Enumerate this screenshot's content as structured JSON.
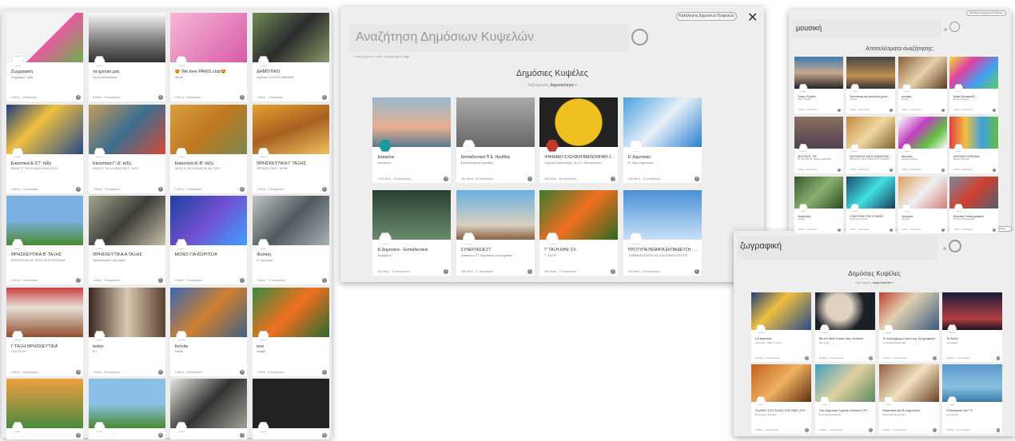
{
  "p1": {
    "cards": [
      {
        "t": "Ζωγραφική",
        "s": "Ζωγραφική - ipiek",
        "m": "4 Μέλη · 4 Ανάρτηση"
      },
      {
        "t": "τα χρόνια μας",
        "s": "τεχνη αναπτυξιοκου",
        "m": "8 Μέλη · 4 Αναρτήσεις"
      },
      {
        "t": "😍 We love PARIS club😍",
        "s": "αποικτ",
        "m": "0 Μέλη · 0 Ανάρτηση"
      },
      {
        "t": "ΔΗΜΟΤΙΚΟ",
        "s": "Δημοτικό ΣΧΟΛΕΙΟ ΑΘΗΝΩΝ",
        "m": "1 Μέλη · 1 Ανάρτηση"
      },
      {
        "t": "Εικαστικά Ε-ΣΤ' τάξη",
        "s": "ΦΙΛΟΣ ΣΤ' ΤΑΞΗ ΕΙΚΑΣΤΙΚΑ Α ΤΑΞΗ",
        "m": "2 Μέλη · 1 Αναρτήσεις"
      },
      {
        "t": "Εικαστικά Γ'-Δ' τάξη",
        "s": "ΦΙΛΟΣ Γ' ΤΑΞΗ ΕΙΚΑΣΤΙΚΑ Γ' ΤΑΞΗ",
        "m": "1 Μέλη · 1 Αναρτήσεις"
      },
      {
        "t": "Εικαστικά Α'-Β' τάξη",
        "s": "ΦΙΛΟΣ Α' ΤΑΞΗ ΕΙΚΑΣΤΙΚΑ Β' ΤΑΞΗ",
        "m": "1 Μέλη · 1 Αναρτήσεις"
      },
      {
        "t": "ΘΡΗΣΚΕΥΤΙΚΑ Γ ΤΑΞΗΣ",
        "s": "ΘΡΗΣΚΕΥΤΙΚΑ Γ ΤΑΞΗΣ",
        "m": "1 Μέλη · 1 Αναρτήσεις"
      },
      {
        "t": "ΘΡΗΣΚΕΥΤΙΚΑ Β' ΤΑΞΗΣ",
        "s": "ΘΡΗΣΚΕΥΤΙΚΑ Β' ΤΑΞΗΣ ΧΡΙΣΤΟΥΓΕΝΝΑ",
        "m": "1 Μέλη · 1 Αναρτήσεις"
      },
      {
        "t": "ΘΡΗΣΚΕΥΤΙΚΑ Α ΤΑΞΗΣ",
        "s": "Θρησκευτικά Α' ταξη Αγίου",
        "m": "1 Μέλη · 0 Αναρτήσεις"
      },
      {
        "t": "ΜΟΝΟ ΓΙΑ ΚΟΡΙΤΣΙΑ",
        "s": "··",
        "m": "0 Μέλη · 0 Αναρτήσεις"
      },
      {
        "t": "Φυσική",
        "s": "Α' Γυμνασίου",
        "m": "1 Μέλη · 17 Αναρτήσεις"
      },
      {
        "t": "Γ ΤΑΞΗ ΘΡΗΣΚΕΥΤΙΚΑ",
        "s": "ΤΟ Β ΤΑΞΗ",
        "m": "1 Μέλη · 0 Αναρτήσεις"
      },
      {
        "t": "tedes",
        "s": "Β' Γ",
        "m": "1 Μέλη · 0 Αναρτήσεις"
      },
      {
        "t": "fortnite",
        "s": "fortnite",
        "m": "4 Μέλη · 0 Αναρτήσεις"
      },
      {
        "t": "test",
        "s": "unsigia",
        "m": "1 Μέλη · 0 Αναρτήσεις"
      },
      {
        "t": "",
        "s": "",
        "m": ""
      },
      {
        "t": "",
        "s": "",
        "m": ""
      },
      {
        "t": "",
        "s": "",
        "m": ""
      },
      {
        "t": "",
        "s": "",
        "m": ""
      }
    ]
  },
  "p2": {
    "catalog_btn": "Κατάλογος Δημόσιων Κυψελών",
    "close": "✕",
    "search_placeholder": "Αναζήτηση Δημόσιων Κυψελών",
    "hint": "* Αναζήτηση σε τίτλο, περιγραφή & tags",
    "heading": "Δημόσιες Κυψέλες",
    "sort_label": "Ταξινόμηση:",
    "sort_value": "Δημοτικότητα",
    "cards": [
      {
        "t": "Δάσκαλοι",
        "s": "Δασκάλοι",
        "m": "1789 Μέλη · 90 Αναρτήσεις"
      },
      {
        "t": "Εκπαιδευτικοί Π.Ε. Ημαθίας",
        "s": "Εκπαιδευτικοί Ημαθίας",
        "m": "491 Μέλη · 60 Αναρτήσεις"
      },
      {
        "t": "ΨΗΦΙΑΚΗ ΣΧΟΛΙΚΗ ΒΙΒΛΙΟΘΗΚΗ 1ου ΔΗΜΟΤΙΚΟΥ...",
        "s": "Σχολική Βιβλιοθήκη \"Α.Δ.Σ. Μελισσέκιοκ...",
        "m": "459 Μέλη · 55 Αναρτήσεις"
      },
      {
        "t": "Ε' Δημοτικού",
        "s": "Ε' τάξη Δημοτικού",
        "m": "408 Μέλη · 22 Αναρτήσεις"
      },
      {
        "t": "Δ' Δημοτικού - Εκπαιδευτικοί",
        "s": "Αλφάβητο",
        "m": "404 Μέλη · 16 Αναρτήσεις"
      },
      {
        "t": "ΣΥΝΕΡΓΑΣΙΑ ΣΤ",
        "s": "Δάσκαλοι ΣΤ Δημοτικού Συνεργασία",
        "m": "398 Μέλη · 27 Αναρτήσεις"
      },
      {
        "t": "Γ' ΤΑΞΗ ΔΗΜ. ΣΧ.",
        "s": "Γ' ΤΑΞΗ",
        "m": "388 Μέλη · 17 Αναρτήσεις"
      },
      {
        "t": "ΠΡΟΤΥΠΑ ΘΕΜΑΤΑ ΕΚΠΑΙΔΕΥΣΗ - ΤΜΗΜΑΤΑ ΕΝΤΑΞΗΣ ...",
        "s": "ΤΜΗΜΑΤΑ ΕΝΤΑΞΗΣ ΚΑΙ ΕΙΔΙΚΗ ΑΓΩΓΗ",
        "m": "382 Μέλη · 20 Αναρτήσεις"
      }
    ]
  },
  "p3": {
    "catalog_btn": "Κατάλογος Δημόσιων Κυψελών",
    "query": "μουσική",
    "results_heading": "Αποτελέσματα αναζήτησης:",
    "cards": [
      {
        "t": "Σάκης Ρουβάς",
        "s": "Σάκης Ρουβάς",
        "m": "1 Μέλη · 1 Αναρτήσεις"
      },
      {
        "t": "Μονυτάκης και μουσόλος μετά Metal και...",
        "s": "μουσική",
        "m": "1 Μέλη · 5 Αναρτήσεις"
      },
      {
        "t": "μουσική",
        "s": "μουσική",
        "m": "0 Μέλη · 1 Αναρτήσεις"
      },
      {
        "t": "Music Mouseo(Κ)",
        "s": "μουσική Σχολείου",
        "m": "1 Μέλη · 0 Αναρτήσεις"
      },
      {
        "t": "ΜΟΥΣΙΚΗ - Β'Γ",
        "s": "Β'Γ, Β'Α, Β'Β, ΒΤ, Μουσική 2018-2019",
        "m": "1 Μέλη · 0 Αναρτήσεις"
      },
      {
        "t": "ΜΟΥΣΙΚΗ Α' ΚΑΙ Β' ΔΗΜΟΤΙΚΟΥ ΣΧΟΛΕΙΟΥ 2018...",
        "s": "ΜΟΥΣΙΚΗ Α' ΚΑΙ Β' ΔΗΜΟΤΙΚΟΥ ΣΧΟΛΕΙΟΥ",
        "m": "1 Μέλη · 0 Αναρτήσεις"
      },
      {
        "t": "Μουσική",
        "s": "Μουσική Σχολείου",
        "m": "1 Μέλη · 0 Αναρτήσεις"
      },
      {
        "t": "ΜΟΥΣΙΚΗ-ΧΟΡΩΔΙΑ",
        "s": "Μουσική Χορωδία",
        "m": "1 Μέλη · 0 Αναρτήσεις"
      },
      {
        "t": "Αναμνήση",
        "s": "μουσική",
        "m": "1 Μέλη · 0 Αναρτήσεις"
      },
      {
        "t": "Η ΜΟΥΣΙΚΗ ΤΗΣ ΣΥΝΘΕΣ",
        "s": "Καθηγητές μουσικής",
        "m": "1 Μέλη · 0 Αναρτήσεις"
      },
      {
        "t": "Χρώματα",
        "s": "Χρώματα",
        "m": "1 Μέλη · 0 Αναρτήσεις"
      },
      {
        "t": "Μουσική Παλαιογραφική",
        "s": "Μουσική Παλαιογραφική",
        "m": "1 Μέλη · 0 Αναρτήσεις"
      }
    ]
  },
  "p4": {
    "catalog_btn": "Κατάλογος Δημόσιων Κυψελών",
    "query": "ζωγραφική",
    "heading": "Δημόσιες Κυψέλες",
    "sort_label": "Ταξινόμηση:",
    "sort_value": "Δημοτικότητα",
    "cards": [
      {
        "t": "ο Εικαστικα",
        "s": "εικαστικά - τάξεις Γ' και Δ'",
        "m": "44 Μέλη · 4 Αναρτήσεις"
      },
      {
        "t": "Με τον Βαν Γκογκ στην Ισπανία",
        "s": "Van Gogh",
        "m": "10 Μέλη · 4 Αναρτήσεις"
      },
      {
        "t": "Το πολυχρωμο κουτι της Ζωγραφικής",
        "s": "Ζωγραφική-Εικαστικά",
        "m": "5 Μέλη · 2 Αναρτήσεις"
      },
      {
        "t": "Τα Καλα",
        "s": "ζωγραφική",
        "m": "5 Μέλη · 2 Αναρτήσεις"
      },
      {
        "t": "Το ΔΙΚΟ ΣΟΥ ΚΑΛΟ ΛΟΓΙΣΜΟ (ΤΗΣ ΖΩΓΡΑΦΙΚΗΣ) ΣΧΟΛΙΚ...",
        "s": "Ζωγραφική Σχολεία",
        "m": "3 Μέλη · 3 Αναρτήσεις"
      },
      {
        "t": "7ου Δημοτικό Σχολείο Νεαπολ (ΤΤ-1) ΤΕΤ...",
        "s": "Ζωγραφική Σχολείου",
        "m": "3 Μέλη · 3 Αναρτήσεις"
      },
      {
        "t": "Εικαστικά για Β' Δημοτικού",
        "s": "Εικαστικά Ζωγραφική",
        "m": "3 Μέλη · 3 Αναρτήσεις"
      },
      {
        "t": "Η θαλασσα του ΓΣ",
        "s": "Ζωγραφική",
        "m": "3 Μέλη · 3 Αναρτήσεις"
      }
    ]
  },
  "colors": {
    "teal": "#1a9a9f",
    "red": "#c0392b"
  }
}
